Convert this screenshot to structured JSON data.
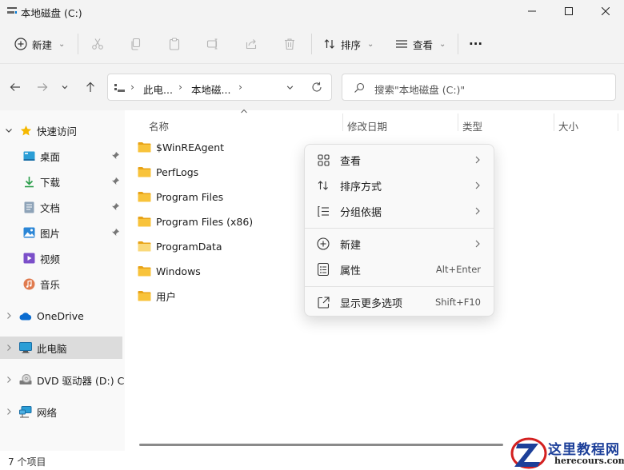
{
  "window": {
    "title": "本地磁盘 (C:)"
  },
  "cmdbar": {
    "new_label": "新建",
    "sort_label": "排序",
    "view_label": "查看",
    "more_label": "···"
  },
  "nav": {
    "breadcrumb": [
      "此电...",
      "本地磁...",
      "›"
    ],
    "search_placeholder": "搜索\"本地磁盘 (C:)\""
  },
  "sidebar": {
    "quick_access": "快速访问",
    "items": [
      {
        "label": "桌面",
        "icon": "desktop-icon",
        "pinned": true
      },
      {
        "label": "下载",
        "icon": "download-icon",
        "pinned": true
      },
      {
        "label": "文档",
        "icon": "document-icon",
        "pinned": true
      },
      {
        "label": "图片",
        "icon": "picture-icon",
        "pinned": true
      },
      {
        "label": "视频",
        "icon": "video-icon",
        "pinned": false
      },
      {
        "label": "音乐",
        "icon": "music-icon",
        "pinned": false
      }
    ],
    "onedrive": "OneDrive",
    "this_pc": "此电脑",
    "dvd": "DVD 驱动器 (D:) CF",
    "network": "网络"
  },
  "columns": {
    "name": "名称",
    "modified": "修改日期",
    "type": "类型",
    "size": "大小"
  },
  "files": [
    {
      "name": "$WinREAgent"
    },
    {
      "name": "PerfLogs"
    },
    {
      "name": "Program Files"
    },
    {
      "name": "Program Files (x86)"
    },
    {
      "name": "ProgramData"
    },
    {
      "name": "Windows"
    },
    {
      "name": "用户"
    }
  ],
  "context_menu": {
    "view": "查看",
    "sort_by": "排序方式",
    "group_by": "分组依据",
    "new": "新建",
    "properties": "属性",
    "properties_shortcut": "Alt+Enter",
    "more_options": "显示更多选项",
    "more_options_shortcut": "Shift+F10"
  },
  "status": {
    "item_count": "7 个项目"
  },
  "watermark": {
    "text_cn": "这里教程网",
    "text_en": "herecours.com"
  },
  "colors": {
    "accent": "#0067c0",
    "folder": "#f8c33b",
    "folder_dark": "#e8a317"
  }
}
